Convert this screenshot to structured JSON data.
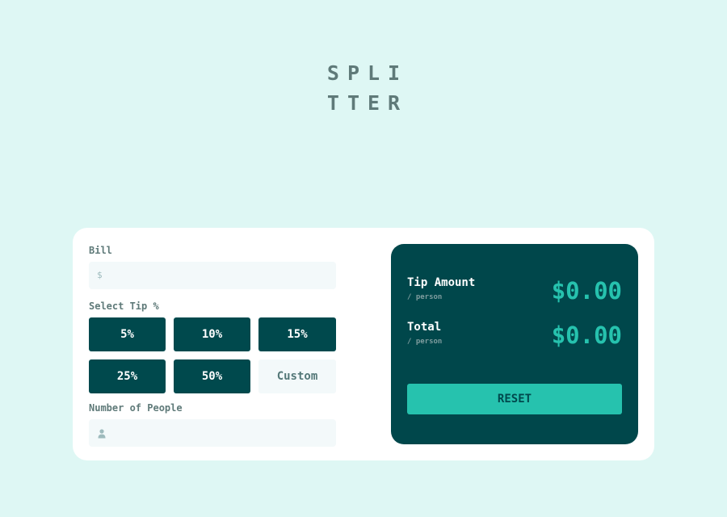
{
  "app": {
    "logo_line1": "SPLI",
    "logo_line2": "TTER"
  },
  "bill": {
    "label": "Bill",
    "icon": "dollar-icon",
    "icon_glyph": "$",
    "value": "",
    "placeholder": ""
  },
  "tip": {
    "label": "Select Tip %",
    "options": [
      "5%",
      "10%",
      "15%",
      "25%",
      "50%"
    ],
    "custom_placeholder": "Custom"
  },
  "people": {
    "label": "Number of People",
    "icon": "person-icon",
    "value": "",
    "placeholder": ""
  },
  "results": {
    "tip_amount": {
      "title": "Tip Amount",
      "sub": "/ person",
      "value": "$0.00"
    },
    "total": {
      "title": "Total",
      "sub": "/ person",
      "value": "$0.00"
    },
    "reset_label": "RESET"
  },
  "colors": {
    "background": "#def7f4",
    "card": "#ffffff",
    "dark_cyan": "#00494d",
    "strong_cyan": "#26c2ae",
    "grayish_cyan": "#5f7a79",
    "input_bg": "#f3f9fa"
  }
}
